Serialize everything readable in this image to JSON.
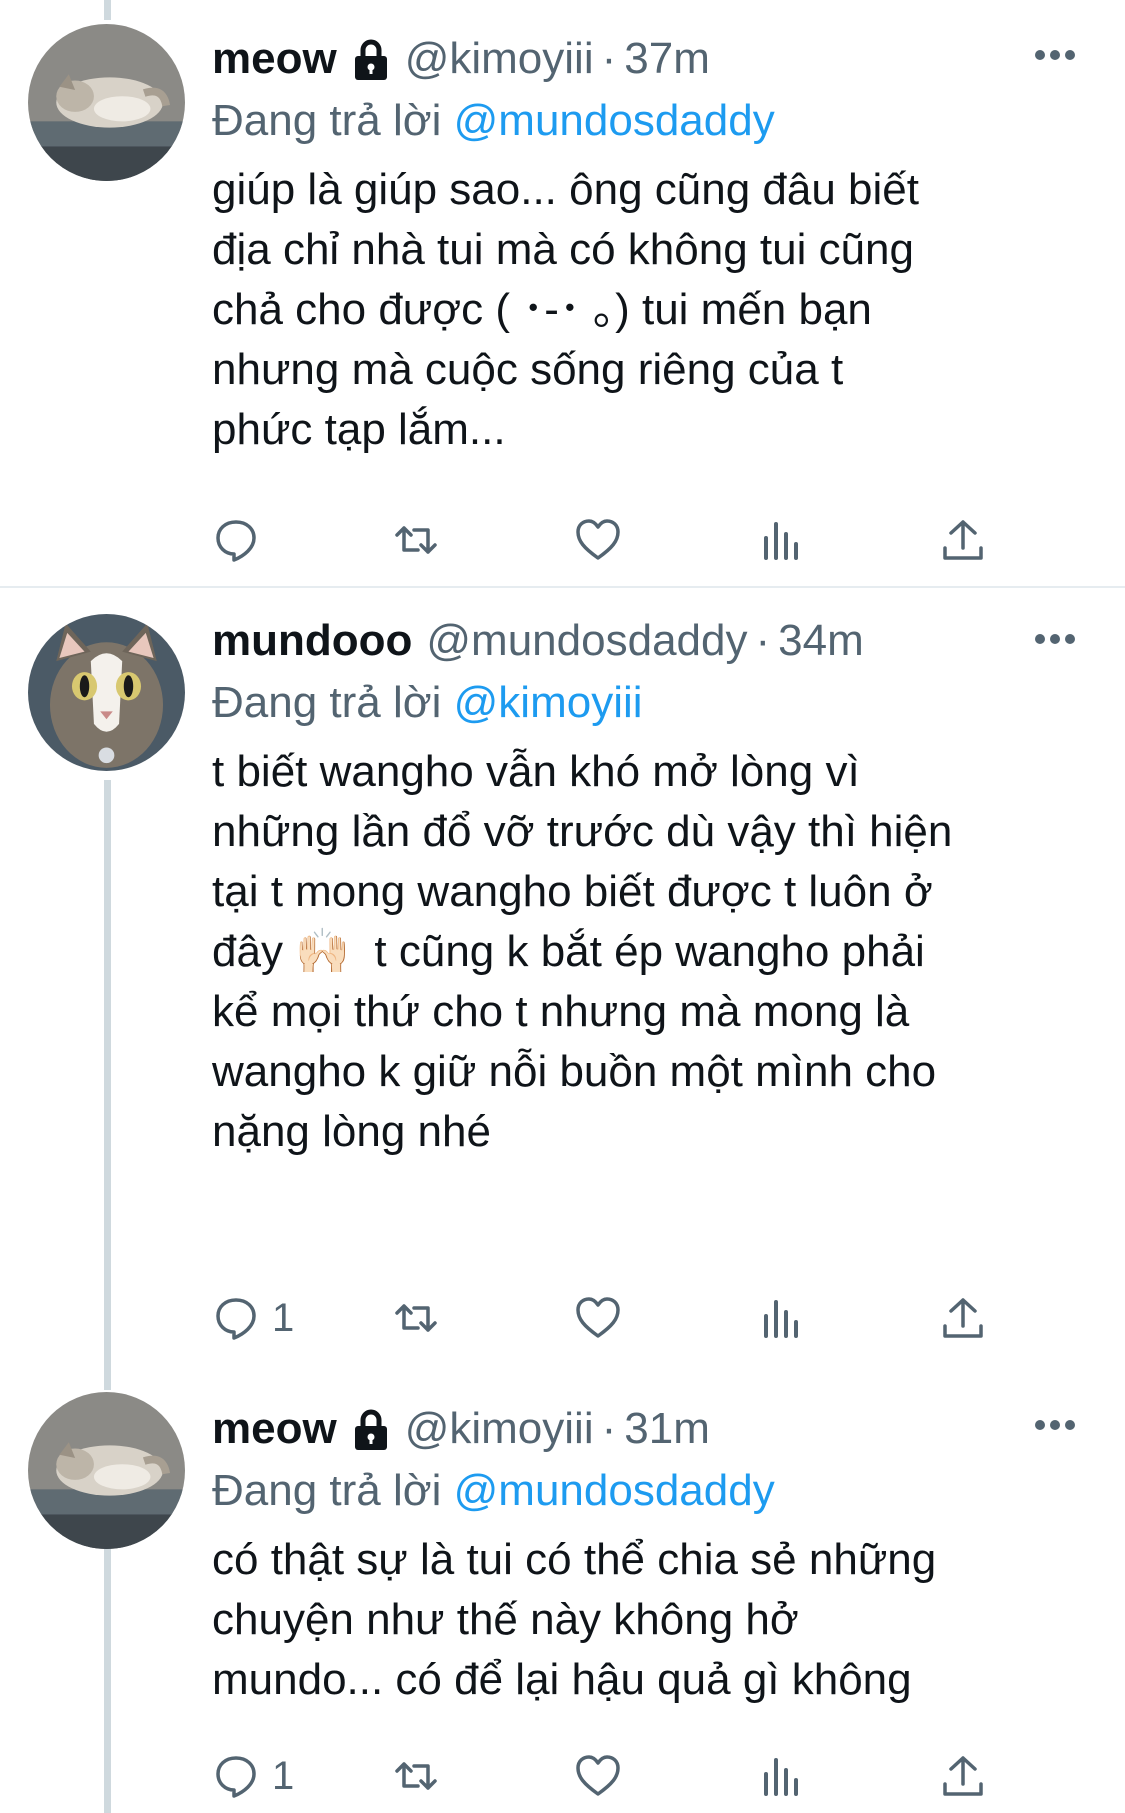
{
  "accent_color": "#1d9bf0",
  "secondary_text_color": "#536471",
  "tweets": [
    {
      "name": "meow",
      "locked": true,
      "handle": "@kimoyiii",
      "separator": "·",
      "time": "37m",
      "reply_prefix": "Đang trả lời",
      "reply_to": "@mundosdaddy",
      "text": "giúp là giúp sao... ông cũng đâu biết\nđịa chỉ nhà tui mà có không tui cũng\nchả cho được ( ･-･ ｡) tui mến bạn\nnhưng mà cuộc sống riêng của t\nphức tạp lắm...",
      "reply_count": "",
      "avatar_icon": "sleeping-cat-avatar"
    },
    {
      "name": "mundooo",
      "locked": false,
      "handle": "@mundosdaddy",
      "separator": "·",
      "time": "34m",
      "reply_prefix": "Đang trả lời",
      "reply_to": "@kimoyiii",
      "text": "t biết wangho vẫn khó mở lòng vì\nnhững lần đổ vỡ trước dù vậy thì hiện\ntại t mong wangho biết được t luôn ở\nđây 🙌🏻  t cũng k bắt ép wangho phải\nkể mọi thứ cho t nhưng mà mong là\nwangho k giữ nỗi buồn một mình cho\nnặng lòng nhé",
      "reply_count": "1",
      "avatar_icon": "tabby-cat-avatar"
    },
    {
      "name": "meow",
      "locked": true,
      "handle": "@kimoyiii",
      "separator": "·",
      "time": "31m",
      "reply_prefix": "Đang trả lời",
      "reply_to": "@mundosdaddy",
      "text": "có thật sự là tui có thể chia sẻ những\nchuyện như thế này không hở\nmundo... có để lại hậu quả gì không",
      "reply_count": "1",
      "avatar_icon": "sleeping-cat-avatar"
    }
  ]
}
